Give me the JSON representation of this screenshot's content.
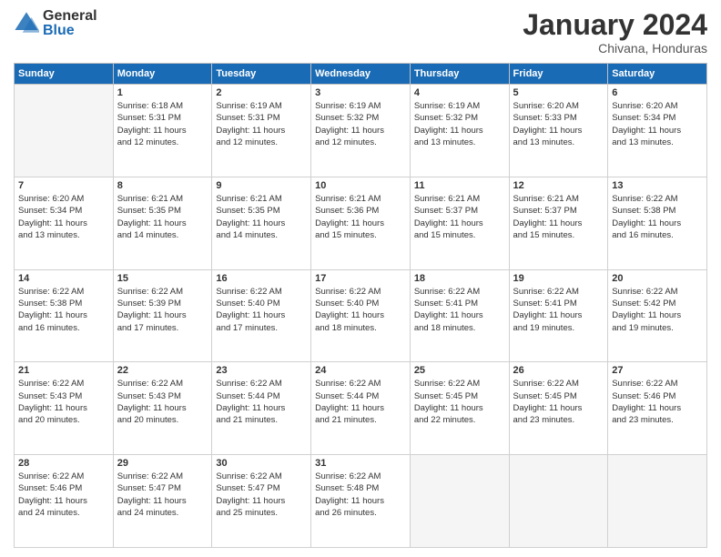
{
  "logo": {
    "general": "General",
    "blue": "Blue"
  },
  "calendar": {
    "title": "January 2024",
    "subtitle": "Chivana, Honduras",
    "days_of_week": [
      "Sunday",
      "Monday",
      "Tuesday",
      "Wednesday",
      "Thursday",
      "Friday",
      "Saturday"
    ],
    "weeks": [
      [
        {
          "day": "",
          "info": ""
        },
        {
          "day": "1",
          "info": "Sunrise: 6:18 AM\nSunset: 5:31 PM\nDaylight: 11 hours\nand 12 minutes."
        },
        {
          "day": "2",
          "info": "Sunrise: 6:19 AM\nSunset: 5:31 PM\nDaylight: 11 hours\nand 12 minutes."
        },
        {
          "day": "3",
          "info": "Sunrise: 6:19 AM\nSunset: 5:32 PM\nDaylight: 11 hours\nand 12 minutes."
        },
        {
          "day": "4",
          "info": "Sunrise: 6:19 AM\nSunset: 5:32 PM\nDaylight: 11 hours\nand 13 minutes."
        },
        {
          "day": "5",
          "info": "Sunrise: 6:20 AM\nSunset: 5:33 PM\nDaylight: 11 hours\nand 13 minutes."
        },
        {
          "day": "6",
          "info": "Sunrise: 6:20 AM\nSunset: 5:34 PM\nDaylight: 11 hours\nand 13 minutes."
        }
      ],
      [
        {
          "day": "7",
          "info": "Sunrise: 6:20 AM\nSunset: 5:34 PM\nDaylight: 11 hours\nand 13 minutes."
        },
        {
          "day": "8",
          "info": "Sunrise: 6:21 AM\nSunset: 5:35 PM\nDaylight: 11 hours\nand 14 minutes."
        },
        {
          "day": "9",
          "info": "Sunrise: 6:21 AM\nSunset: 5:35 PM\nDaylight: 11 hours\nand 14 minutes."
        },
        {
          "day": "10",
          "info": "Sunrise: 6:21 AM\nSunset: 5:36 PM\nDaylight: 11 hours\nand 15 minutes."
        },
        {
          "day": "11",
          "info": "Sunrise: 6:21 AM\nSunset: 5:37 PM\nDaylight: 11 hours\nand 15 minutes."
        },
        {
          "day": "12",
          "info": "Sunrise: 6:21 AM\nSunset: 5:37 PM\nDaylight: 11 hours\nand 15 minutes."
        },
        {
          "day": "13",
          "info": "Sunrise: 6:22 AM\nSunset: 5:38 PM\nDaylight: 11 hours\nand 16 minutes."
        }
      ],
      [
        {
          "day": "14",
          "info": "Sunrise: 6:22 AM\nSunset: 5:38 PM\nDaylight: 11 hours\nand 16 minutes."
        },
        {
          "day": "15",
          "info": "Sunrise: 6:22 AM\nSunset: 5:39 PM\nDaylight: 11 hours\nand 17 minutes."
        },
        {
          "day": "16",
          "info": "Sunrise: 6:22 AM\nSunset: 5:40 PM\nDaylight: 11 hours\nand 17 minutes."
        },
        {
          "day": "17",
          "info": "Sunrise: 6:22 AM\nSunset: 5:40 PM\nDaylight: 11 hours\nand 18 minutes."
        },
        {
          "day": "18",
          "info": "Sunrise: 6:22 AM\nSunset: 5:41 PM\nDaylight: 11 hours\nand 18 minutes."
        },
        {
          "day": "19",
          "info": "Sunrise: 6:22 AM\nSunset: 5:41 PM\nDaylight: 11 hours\nand 19 minutes."
        },
        {
          "day": "20",
          "info": "Sunrise: 6:22 AM\nSunset: 5:42 PM\nDaylight: 11 hours\nand 19 minutes."
        }
      ],
      [
        {
          "day": "21",
          "info": "Sunrise: 6:22 AM\nSunset: 5:43 PM\nDaylight: 11 hours\nand 20 minutes."
        },
        {
          "day": "22",
          "info": "Sunrise: 6:22 AM\nSunset: 5:43 PM\nDaylight: 11 hours\nand 20 minutes."
        },
        {
          "day": "23",
          "info": "Sunrise: 6:22 AM\nSunset: 5:44 PM\nDaylight: 11 hours\nand 21 minutes."
        },
        {
          "day": "24",
          "info": "Sunrise: 6:22 AM\nSunset: 5:44 PM\nDaylight: 11 hours\nand 21 minutes."
        },
        {
          "day": "25",
          "info": "Sunrise: 6:22 AM\nSunset: 5:45 PM\nDaylight: 11 hours\nand 22 minutes."
        },
        {
          "day": "26",
          "info": "Sunrise: 6:22 AM\nSunset: 5:45 PM\nDaylight: 11 hours\nand 23 minutes."
        },
        {
          "day": "27",
          "info": "Sunrise: 6:22 AM\nSunset: 5:46 PM\nDaylight: 11 hours\nand 23 minutes."
        }
      ],
      [
        {
          "day": "28",
          "info": "Sunrise: 6:22 AM\nSunset: 5:46 PM\nDaylight: 11 hours\nand 24 minutes."
        },
        {
          "day": "29",
          "info": "Sunrise: 6:22 AM\nSunset: 5:47 PM\nDaylight: 11 hours\nand 24 minutes."
        },
        {
          "day": "30",
          "info": "Sunrise: 6:22 AM\nSunset: 5:47 PM\nDaylight: 11 hours\nand 25 minutes."
        },
        {
          "day": "31",
          "info": "Sunrise: 6:22 AM\nSunset: 5:48 PM\nDaylight: 11 hours\nand 26 minutes."
        },
        {
          "day": "",
          "info": ""
        },
        {
          "day": "",
          "info": ""
        },
        {
          "day": "",
          "info": ""
        }
      ]
    ]
  }
}
